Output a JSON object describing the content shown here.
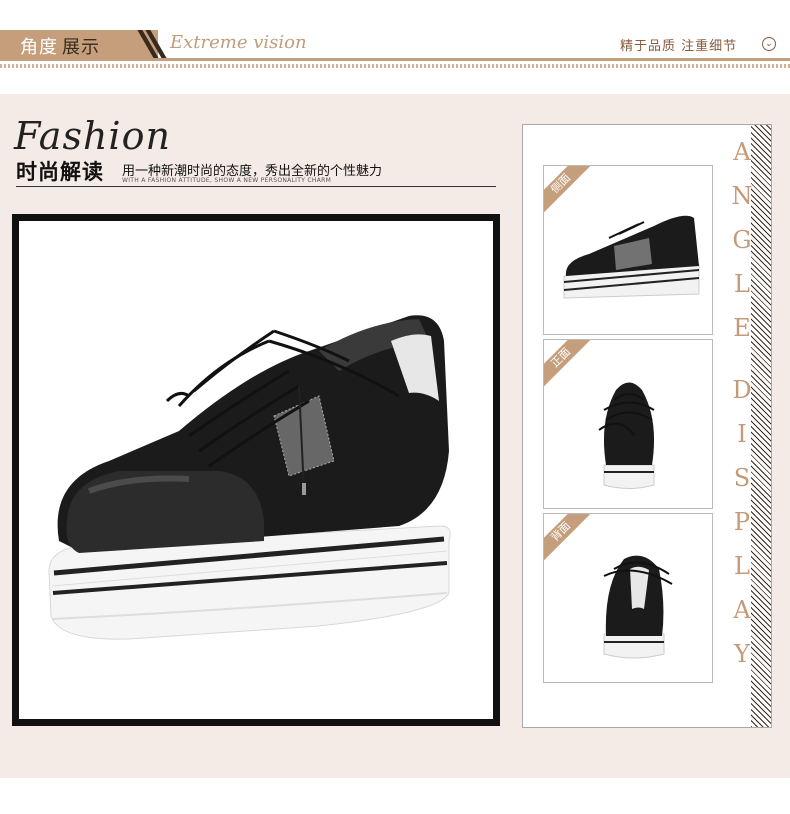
{
  "banner": {
    "tab_light": "角度",
    "tab_dark": "展示",
    "subtitle": "Extreme vision",
    "right_text": "精于品质 注重细节",
    "chevron_icon": "chevron-down-circle-icon"
  },
  "fashion": {
    "title": "Fashion",
    "heading": "时尚解读",
    "description": "用一种新潮时尚的态度，秀出全新的个性魅力",
    "subcaption": "WITH A FASHION ATTITUDE, SHOW A NEW PERSONALITY CHARM"
  },
  "side_panel": {
    "vertical_letters": [
      "A",
      "N",
      "G",
      "L",
      "E",
      " ",
      "D",
      "I",
      "S",
      "P",
      "L",
      "A",
      "Y"
    ],
    "thumbs": [
      {
        "label": "侧面"
      },
      {
        "label": "正面"
      },
      {
        "label": "背面"
      }
    ]
  },
  "colors": {
    "accent": "#c59f7c",
    "content_bg": "#f4ebe6",
    "frame_black": "#111111"
  }
}
